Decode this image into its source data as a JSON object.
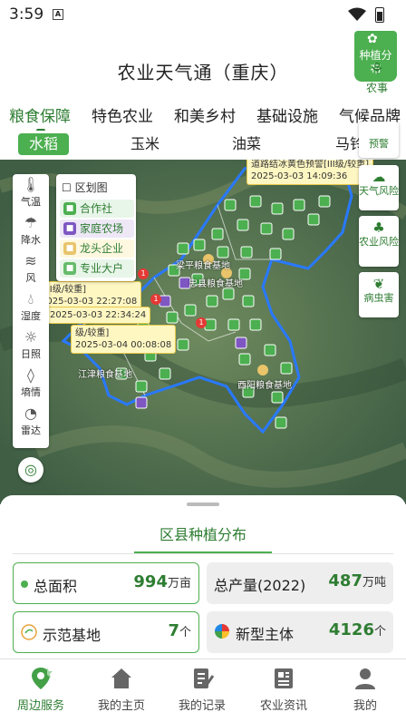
{
  "status_bar": {
    "time": "3:59",
    "sim_icon": "sim-icon",
    "wifi_icon": "wifi-icon",
    "battery_icon": "battery-icon"
  },
  "header": {
    "title": "农业天气通（重庆）",
    "plant_button": "种植分布",
    "farm_button": "农事"
  },
  "main_tabs": [
    "粮食保障",
    "特色农业",
    "和美乡村",
    "基础设施",
    "气候品牌"
  ],
  "sub_tabs": [
    "水稻",
    "玉米",
    "油菜",
    "马铃薯"
  ],
  "layers": [
    "气温",
    "降水",
    "风",
    "湿度",
    "日照",
    "墒情",
    "雷达"
  ],
  "legend": {
    "title": "区划图",
    "items": [
      "合作社",
      "家庭农场",
      "龙头企业",
      "专业大户"
    ]
  },
  "risk_panel": [
    "预警",
    "天气风险",
    "农业风险",
    "病虫害"
  ],
  "warnings": [
    {
      "text": "道路结冰黄色预警[III级/较重]",
      "time": "2025-03-03 14:09:36"
    },
    {
      "text": "[III级/较重]",
      "time": "2025-03-03 22:27:08"
    },
    {
      "text": "",
      "time": "2025-03-03 22:34:24"
    },
    {
      "text": "级/较重]",
      "time": "2025-03-04 00:08:08"
    }
  ],
  "base_labels": [
    "梁平粮食基地",
    "忠县粮食基地",
    "江津粮食基地",
    "酉阳粮食基地"
  ],
  "sheet": {
    "title": "区县种植分布",
    "cards": [
      {
        "label": "总面积",
        "value": "994",
        "unit": "万亩"
      },
      {
        "label": "总产量(2022)",
        "value": "487",
        "unit": "万吨"
      },
      {
        "label": "示范基地",
        "value": "7",
        "unit": "个"
      },
      {
        "label": "新型主体",
        "value": "4126",
        "unit": "个"
      }
    ]
  },
  "bottom_nav": [
    "周边服务",
    "我的主页",
    "我的记录",
    "农业资讯",
    "我的"
  ],
  "colors": {
    "accent": "#4caf50",
    "accent_dark": "#2e7d32",
    "warning": "#fff7c2",
    "boundary": "#2979ff"
  }
}
